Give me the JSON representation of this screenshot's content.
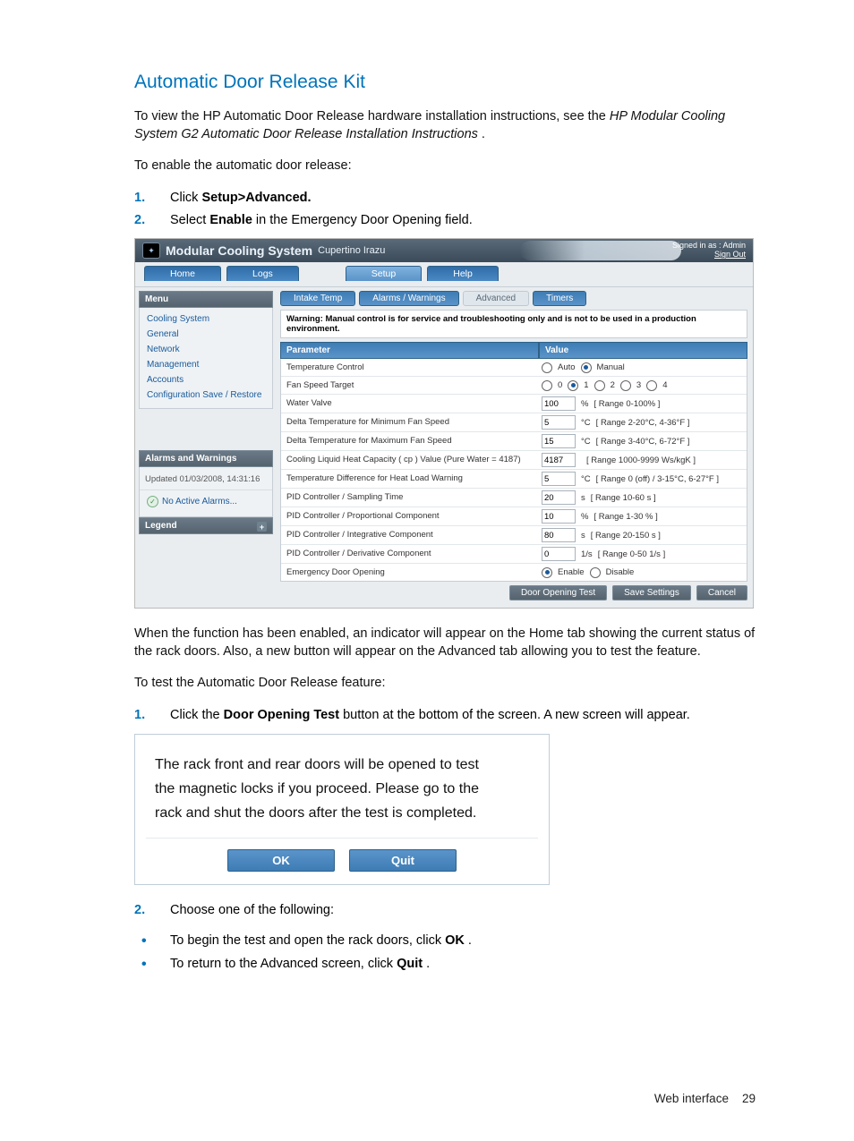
{
  "heading": "Automatic Door Release Kit",
  "intro1_a": "To view the HP Automatic Door Release hardware installation instructions, see the ",
  "intro1_b": "HP Modular Cooling System G2 Automatic Door Release Installation Instructions",
  "intro1_c": ".",
  "intro2": "To enable the automatic door release:",
  "step1_a": "Click ",
  "step1_b": "Setup>Advanced.",
  "step2_a": "Select ",
  "step2_b": "Enable",
  "step2_c": " in the Emergency Door Opening field.",
  "app": {
    "title": "Modular Cooling System",
    "subtitle": "Cupertino Irazu",
    "signedin": "Signed in as : Admin",
    "signout": "Sign Out",
    "nav": {
      "home": "Home",
      "logs": "Logs",
      "setup": "Setup",
      "help": "Help"
    },
    "menu": {
      "header": "Menu",
      "items": [
        "Cooling System",
        "General",
        "Network",
        "Management",
        "Accounts",
        "Configuration Save / Restore"
      ]
    },
    "alarms": {
      "header": "Alarms and Warnings",
      "updated": "Updated 01/03/2008, 14:31:16",
      "noactive": "No Active Alarms..."
    },
    "legend": "Legend",
    "tabs2": {
      "intake": "Intake Temp",
      "aw": "Alarms / Warnings",
      "advanced": "Advanced",
      "timers": "Timers"
    },
    "warning": "Warning: Manual control is for service and troubleshooting only and is not to be used in a production environment.",
    "cols": {
      "param": "Parameter",
      "value": "Value"
    },
    "rows": {
      "r1": {
        "p": "Temperature Control",
        "auto": "Auto",
        "manual": "Manual"
      },
      "r2": {
        "p": "Fan Speed Target",
        "o0": "0",
        "o1": "1",
        "o2": "2",
        "o3": "3",
        "o4": "4"
      },
      "r3": {
        "p": "Water Valve",
        "v": "100",
        "u": "%",
        "h": "[ Range 0-100% ]"
      },
      "r4": {
        "p": "Delta Temperature for Minimum Fan Speed",
        "v": "5",
        "u": "°C",
        "h": "[ Range 2-20°C, 4-36°F ]"
      },
      "r5": {
        "p": "Delta Temperature for Maximum Fan Speed",
        "v": "15",
        "u": "°C",
        "h": "[ Range 3-40°C, 6-72°F ]"
      },
      "r6": {
        "p": "Cooling Liquid Heat Capacity ( cp ) Value (Pure Water = 4187)",
        "v": "4187",
        "h": "[ Range 1000-9999 Ws/kgK ]"
      },
      "r7": {
        "p": "Temperature Difference for Heat Load Warning",
        "v": "5",
        "u": "°C",
        "h": "[ Range 0 (off) / 3-15°C, 6-27°F ]"
      },
      "r8": {
        "p": "PID Controller / Sampling Time",
        "v": "20",
        "u": "s",
        "h": "[ Range 10-60 s ]"
      },
      "r9": {
        "p": "PID Controller / Proportional Component",
        "v": "10",
        "u": "%",
        "h": "[ Range 1-30 % ]"
      },
      "r10": {
        "p": "PID Controller / Integrative Component",
        "v": "80",
        "u": "s",
        "h": "[ Range 20-150 s ]"
      },
      "r11": {
        "p": "PID Controller / Derivative Component",
        "v": "0",
        "u": "1/s",
        "h": "[ Range 0-50 1/s ]"
      },
      "r12": {
        "p": "Emergency Door Opening",
        "enable": "Enable",
        "disable": "Disable"
      }
    },
    "buttons": {
      "test": "Door Opening Test",
      "save": "Save Settings",
      "cancel": "Cancel"
    }
  },
  "para_after1": "When the function has been enabled, an indicator will appear on the Home tab showing the current status of the rack doors. Also, a new button will appear on the Advanced tab allowing you to test the feature.",
  "para_after2": "To test the Automatic Door Release feature:",
  "step_b1_a": "Click the ",
  "step_b1_b": "Door Opening Test",
  "step_b1_c": " button at the bottom of the screen. A new screen will appear.",
  "dialog": {
    "line1": "The rack front and rear doors will be opened to test",
    "line2": "the magnetic locks if you proceed. Please go to the",
    "line3": "rack and shut the doors after the test is completed.",
    "ok": "OK",
    "quit": "Quit"
  },
  "step_c2": "Choose one of the following:",
  "bullet1_a": "To begin the test and open the rack doors, click ",
  "bullet1_b": "OK",
  "bullet1_c": ".",
  "bullet2_a": "To return to the Advanced screen, click ",
  "bullet2_b": "Quit",
  "bullet2_c": ".",
  "footer_a": "Web interface",
  "footer_b": "29"
}
